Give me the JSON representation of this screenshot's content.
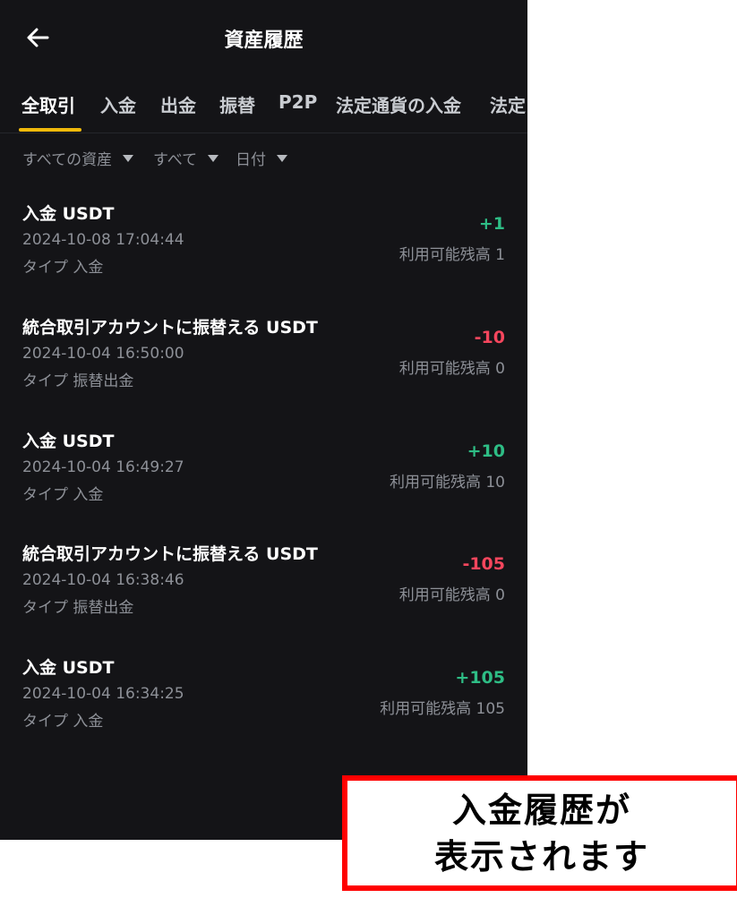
{
  "header": {
    "title": "資産履歴"
  },
  "tabs": [
    {
      "label": "全取引",
      "active": true
    },
    {
      "label": "入金"
    },
    {
      "label": "出金"
    },
    {
      "label": "振替"
    },
    {
      "label": "P2P"
    },
    {
      "label": "法定通貨の入金"
    },
    {
      "label": "法定"
    }
  ],
  "filters": [
    {
      "label": "すべての資産"
    },
    {
      "label": "すべて"
    },
    {
      "label": "日付"
    }
  ],
  "transactions": [
    {
      "title": "入金 USDT",
      "datetime": "2024-10-08 17:04:44",
      "type": "タイプ 入金",
      "amount": "+1",
      "direction": "positive",
      "balance": "利用可能残高 1"
    },
    {
      "title": "統合取引アカウントに振替える USDT",
      "datetime": "2024-10-04 16:50:00",
      "type": "タイプ 振替出金",
      "amount": "-10",
      "direction": "negative",
      "balance": "利用可能残高 0"
    },
    {
      "title": "入金 USDT",
      "datetime": "2024-10-04 16:49:27",
      "type": "タイプ 入金",
      "amount": "+10",
      "direction": "positive",
      "balance": "利用可能残高 10"
    },
    {
      "title": "統合取引アカウントに振替える USDT",
      "datetime": "2024-10-04 16:38:46",
      "type": "タイプ 振替出金",
      "amount": "-105",
      "direction": "negative",
      "balance": "利用可能残高 0"
    },
    {
      "title": "入金 USDT",
      "datetime": "2024-10-04 16:34:25",
      "type": "タイプ 入金",
      "amount": "+105",
      "direction": "positive",
      "balance": "利用可能残高 105"
    }
  ],
  "callout": {
    "line1": "入金履歴が",
    "line2": "表示されます"
  },
  "colors": {
    "background": "#141417",
    "accent": "#f0b90b",
    "positive": "#2ebd85",
    "negative": "#f6465d",
    "callout_border": "#ff0000"
  },
  "icons": {
    "back": "arrow-left-icon",
    "dropdown": "caret-down-icon"
  }
}
